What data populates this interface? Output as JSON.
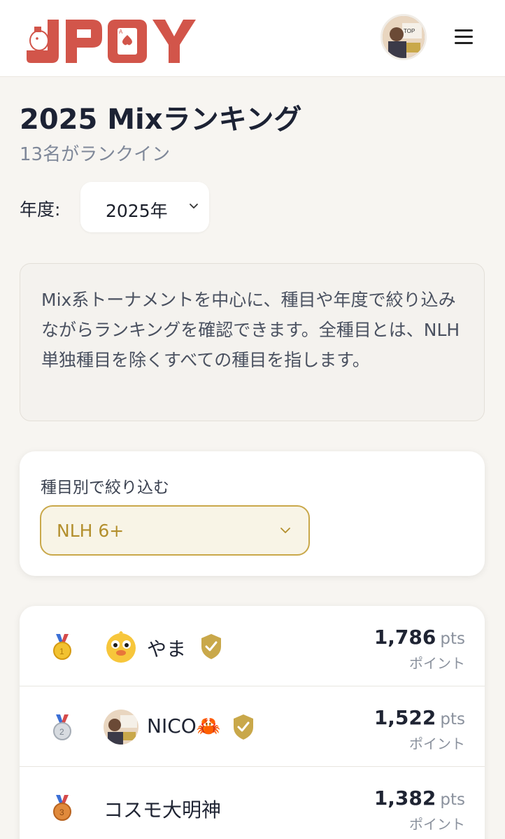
{
  "header": {
    "logo_text": "JPOY",
    "avatar_icon": "user-avatar",
    "menu_icon": "hamburger-menu-icon"
  },
  "page": {
    "title": "2025 Mixランキング",
    "subtitle": "13名がランクイン"
  },
  "year_filter": {
    "label": "年度:",
    "value": "2025年"
  },
  "info": {
    "text": "Mix系トーナメントを中心に、種目や年度で絞り込みながらランキングを確認できます。全種目とは、NLH単独種目を除くすべての種目を指します。"
  },
  "event_filter": {
    "label": "種目別で絞り込む",
    "value": "NLH 6+"
  },
  "rankings": [
    {
      "rank": 1,
      "medal": "gold-medal-icon",
      "name": "やま",
      "points": "1,786",
      "unit": "pts",
      "sub": "ポイント",
      "verified": true
    },
    {
      "rank": 2,
      "medal": "silver-medal-icon",
      "name": "NICO🦀",
      "points": "1,522",
      "unit": "pts",
      "sub": "ポイント",
      "verified": true
    },
    {
      "rank": 3,
      "medal": "bronze-medal-icon",
      "name": "コスモ大明神",
      "points": "1,382",
      "unit": "pts",
      "sub": "ポイント",
      "verified": false
    }
  ],
  "colors": {
    "brand_red": "#d2554a",
    "accent_gold": "#c9a84a",
    "text_dark": "#1f2433"
  }
}
